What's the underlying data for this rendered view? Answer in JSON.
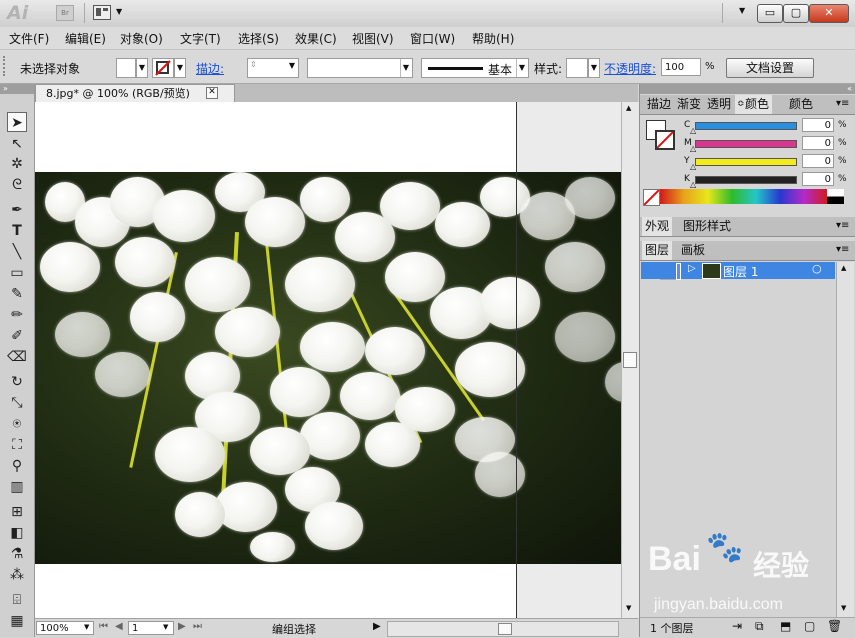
{
  "titlebar": {
    "logo": "Ai",
    "bridge": "Br",
    "arrange_dropdown": "▼",
    "workspace_dropdown": "▼",
    "min": "▭",
    "max": "▢",
    "close": "✕"
  },
  "menu": [
    "文件(F)",
    "编辑(E)",
    "对象(O)",
    "文字(T)",
    "选择(S)",
    "效果(C)",
    "视图(V)",
    "窗口(W)",
    "帮助(H)"
  ],
  "control": {
    "selection": "未选择对象",
    "stroke_label": "描边:",
    "line_profile": "基本",
    "style_label": "样式:",
    "opacity_label": "不透明度:",
    "opacity_value": "100",
    "opacity_unit": "%",
    "doc_setup": "文档设置"
  },
  "document": {
    "tab_title": "8.jpg* @ 100% (RGB/预览)",
    "tab_close": "✕"
  },
  "status": {
    "zoom": "100%",
    "artboard": "1",
    "tool": "编组选择"
  },
  "color_panel": {
    "tabs": [
      "描边",
      "渐变",
      "透明",
      "颜色",
      "颜色"
    ],
    "channels": [
      {
        "label": "C",
        "value": "0",
        "unit": "%",
        "color": "#2a8fe0"
      },
      {
        "label": "M",
        "value": "0",
        "unit": "%",
        "color": "#d8368f"
      },
      {
        "label": "Y",
        "value": "0",
        "unit": "%",
        "color": "#f2ec1a"
      },
      {
        "label": "K",
        "value": "0",
        "unit": "%",
        "color": "#222222"
      }
    ]
  },
  "appearance_panel": {
    "tabs": [
      "外观",
      "图形样式"
    ]
  },
  "layers_panel": {
    "tabs": [
      "图层",
      "画板"
    ],
    "layer_name": "图层 1",
    "count": "1 个图层"
  },
  "watermark": {
    "brand": "Bai",
    "brand2": "经验",
    "url": "jingyan.baidu.com"
  }
}
